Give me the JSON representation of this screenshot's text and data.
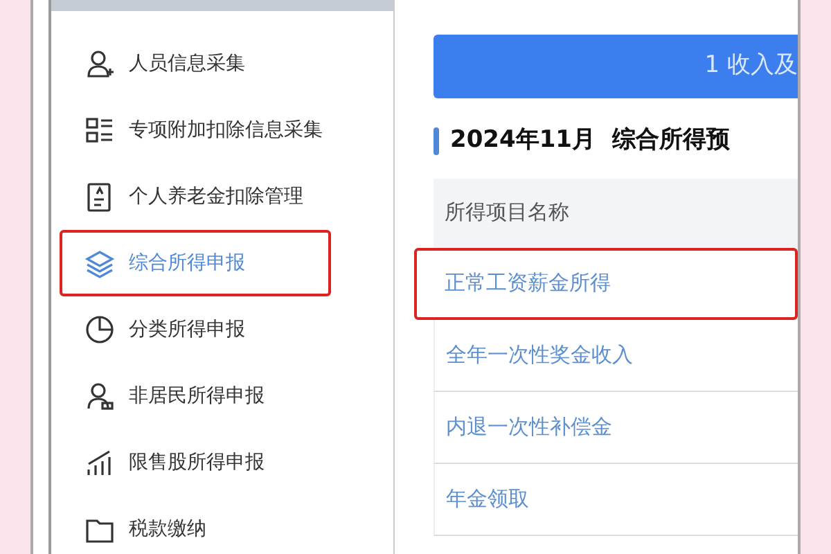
{
  "sidebar": {
    "items": [
      {
        "label": "人员信息采集",
        "selected": false,
        "highlighted": false
      },
      {
        "label": "专项附加扣除信息采集",
        "selected": false,
        "highlighted": false
      },
      {
        "label": "个人养老金扣除管理",
        "selected": false,
        "highlighted": false
      },
      {
        "label": "综合所得申报",
        "selected": true,
        "highlighted": true
      },
      {
        "label": "分类所得申报",
        "selected": false,
        "highlighted": false
      },
      {
        "label": "非居民所得申报",
        "selected": false,
        "highlighted": false
      },
      {
        "label": "限售股所得申报",
        "selected": false,
        "highlighted": false
      },
      {
        "label": "税款缴纳",
        "selected": false,
        "highlighted": false
      }
    ]
  },
  "step_bar": {
    "label": "1 收入及"
  },
  "heading": "2024年11月  综合所得预",
  "table": {
    "columns": [
      "所得项目名称"
    ],
    "rows": [
      {
        "name": "正常工资薪金所得",
        "highlighted": true
      },
      {
        "name": "全年一次性奖金收入",
        "highlighted": false
      },
      {
        "name": "内退一次性补偿金",
        "highlighted": false
      },
      {
        "name": "年金领取",
        "highlighted": false
      }
    ]
  }
}
